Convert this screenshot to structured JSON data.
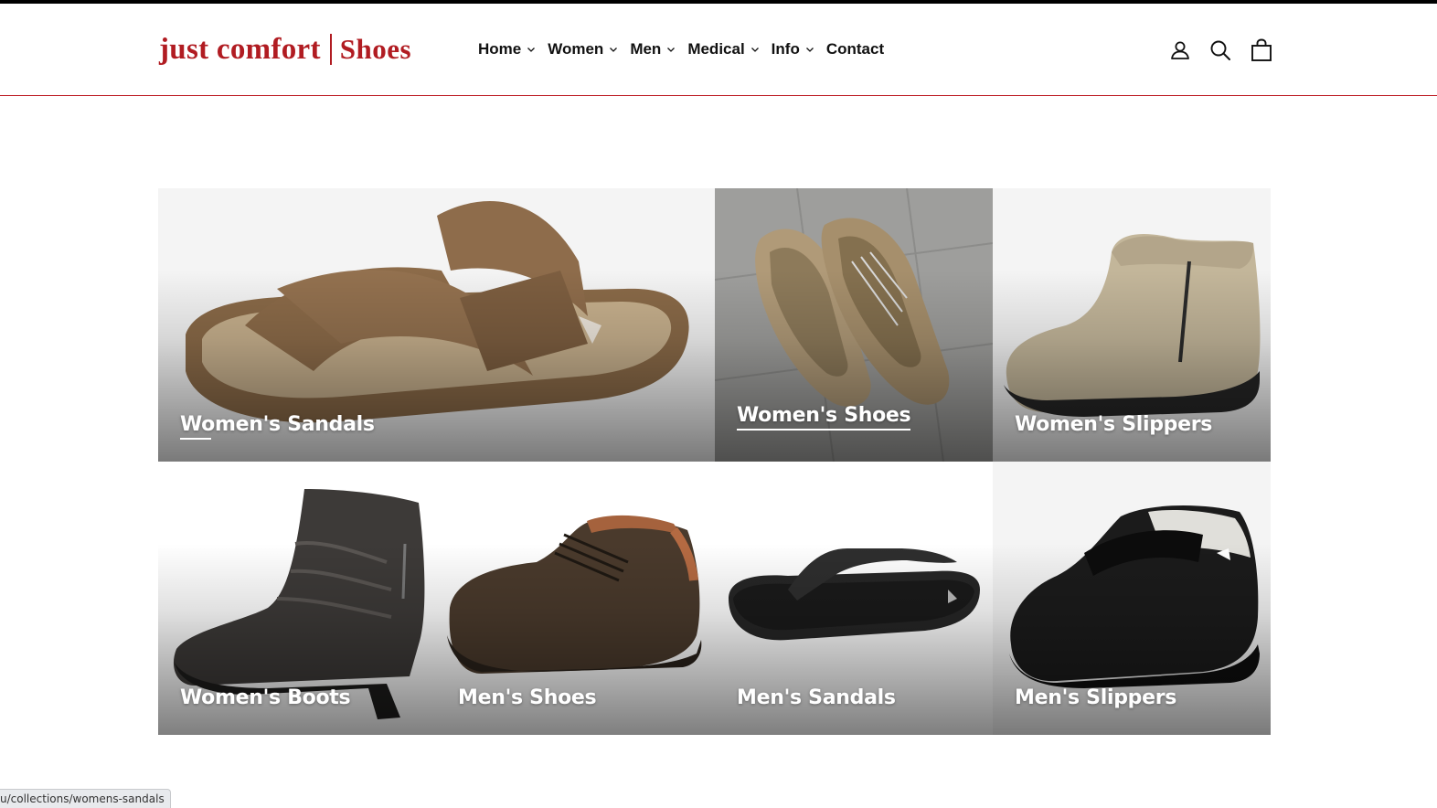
{
  "header": {
    "logo": {
      "main": "just comfort",
      "sub": "Shoes"
    },
    "nav": [
      {
        "label": "Home",
        "dropdown": true
      },
      {
        "label": "Women",
        "dropdown": true
      },
      {
        "label": "Men",
        "dropdown": true
      },
      {
        "label": "Medical",
        "dropdown": true
      },
      {
        "label": "Info",
        "dropdown": true
      },
      {
        "label": "Contact",
        "dropdown": false
      }
    ],
    "icons": [
      "account-icon",
      "search-icon",
      "cart-icon"
    ]
  },
  "collections": [
    {
      "label": "Women's Sandals"
    },
    {
      "label": "Women's Shoes"
    },
    {
      "label": "Women's Slippers"
    },
    {
      "label": "Women's Boots"
    },
    {
      "label": "Men's Shoes"
    },
    {
      "label": "Men's Sandals"
    },
    {
      "label": "Men's Slippers"
    }
  ],
  "status_bar": {
    "url": "u/collections/womens-sandals"
  },
  "colors": {
    "brand": "#b11c22",
    "header_rule": "#c0262d"
  }
}
